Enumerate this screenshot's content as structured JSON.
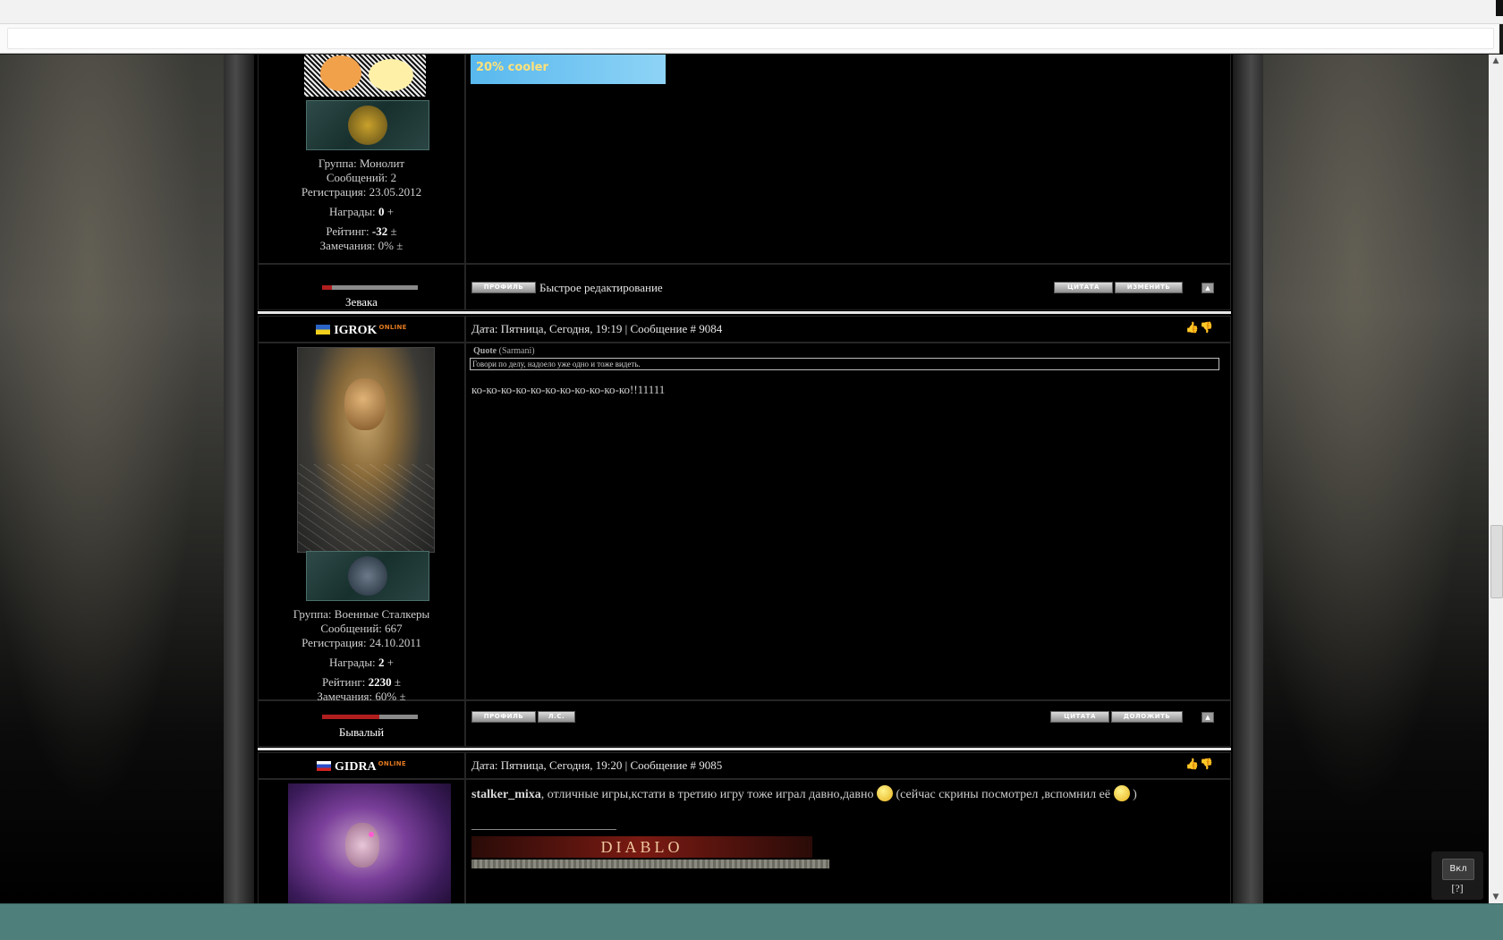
{
  "posts_prev": {
    "group": "Группа: Монолит",
    "messages": "Сообщений: 2",
    "registration": "Регистрация: 23.05.2012",
    "awards_label": "Награды:",
    "awards_value": "0",
    "rating_label": "Рейтинг:",
    "rating_value": "-32",
    "warnings": "Замечания: 0%",
    "rank": "Зевака",
    "rank_progress": 0.1,
    "banner_text": "20% cooler",
    "quick_edit": "Быстрое редактирование",
    "buttons": {
      "profile": "ПРОФИЛЬ",
      "quote": "ЦИТАТА",
      "edit": "ИЗМЕНИТЬ"
    }
  },
  "post_9084": {
    "username": "IGROK",
    "online": "ONLINE",
    "header": "Дата: Пятница, Сегодня, 19:19 | Сообщение # 9084",
    "quote_title": "Quote",
    "quote_author": "(Sarmani)",
    "quote_text": "Говори по делу, надоело уже одно и тоже видеть.",
    "body": "ко-ко-ко-ко-ко-ко-ко-ко-ко-ко-ко!!11111",
    "group": "Группа: Военные Сталкеры",
    "messages": "Сообщений: 667",
    "registration": "Регистрация: 24.10.2011",
    "awards_label": "Награды:",
    "awards_value": "2",
    "rating_label": "Рейтинг:",
    "rating_value": "2230",
    "warnings": "Замечания: 60%",
    "rank": "Бывалый",
    "rank_progress": 0.6,
    "buttons": {
      "profile": "ПРОФИЛЬ",
      "pm": "Л.С.",
      "quote": "ЦИТАТА",
      "report": "ДОЛОЖИТЬ"
    }
  },
  "post_9085": {
    "username": "GIDRA",
    "online": "ONLINE",
    "header": "Дата: Пятница, Сегодня, 19:20 | Сообщение # 9085",
    "mention": "stalker_mixa",
    "body1": ", отличные игры,кстати в третию игру тоже играл давно,давно",
    "body2": "(сейчас скрины посмотрел ,вспомнил её",
    "body3": ")",
    "signature_logo": "DIABLO"
  },
  "widget": {
    "toggle": "Вкл",
    "help": "[?]"
  },
  "symbols": {
    "plus": "+",
    "plusminus": "±",
    "up": "▲",
    "down": "▼"
  }
}
